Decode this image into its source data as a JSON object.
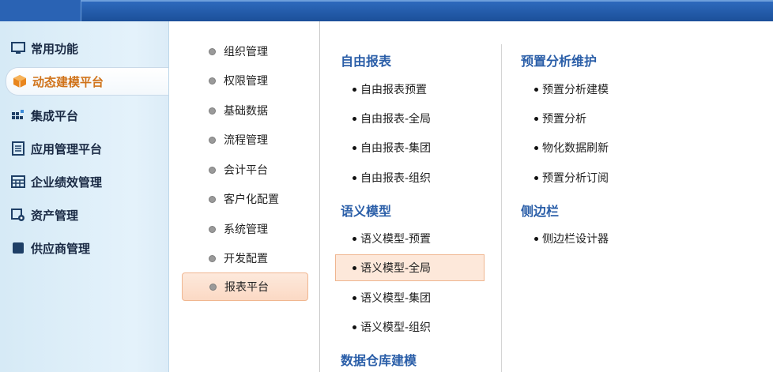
{
  "colors": {
    "topbar": "#1b4f99",
    "sidebar_bg": "#dcecf7",
    "active_text": "#d0731a",
    "section_title": "#2a5ea8",
    "highlight_bg": "#fde8da",
    "highlight_border": "#efb690"
  },
  "sidebar": {
    "items": [
      {
        "label": "常用功能",
        "icon": "monitor-icon"
      },
      {
        "label": "动态建模平台",
        "icon": "cube-icon",
        "active": true
      },
      {
        "label": "集成平台",
        "icon": "grid-integration-icon"
      },
      {
        "label": "应用管理平台",
        "icon": "document-icon"
      },
      {
        "label": "企业绩效管理",
        "icon": "table-icon"
      },
      {
        "label": "资产管理",
        "icon": "asset-gear-icon"
      },
      {
        "label": "供应商管理",
        "icon": "folder-icon"
      }
    ]
  },
  "middle": {
    "items": [
      {
        "label": "组织管理"
      },
      {
        "label": "权限管理"
      },
      {
        "label": "基础数据"
      },
      {
        "label": "流程管理"
      },
      {
        "label": "会计平台"
      },
      {
        "label": "客户化配置"
      },
      {
        "label": "系统管理"
      },
      {
        "label": "开发配置"
      },
      {
        "label": "报表平台",
        "active": true
      }
    ]
  },
  "content": {
    "col1": {
      "sections": [
        {
          "title": "自由报表",
          "links": [
            "自由报表预置",
            "自由报表-全局",
            "自由报表-集团",
            "自由报表-组织"
          ]
        },
        {
          "title": "语义模型",
          "links": [
            "语义模型-预置",
            "语义模型-全局",
            "语义模型-集团",
            "语义模型-组织"
          ]
        },
        {
          "title": "数据仓库建模",
          "links": []
        }
      ]
    },
    "col2": {
      "sections": [
        {
          "title": "预置分析维护",
          "links": [
            "预置分析建模",
            "预置分析",
            "物化数据刷新",
            "预置分析订阅"
          ]
        },
        {
          "title": "侧边栏",
          "links": [
            "侧边栏设计器"
          ]
        }
      ]
    }
  }
}
